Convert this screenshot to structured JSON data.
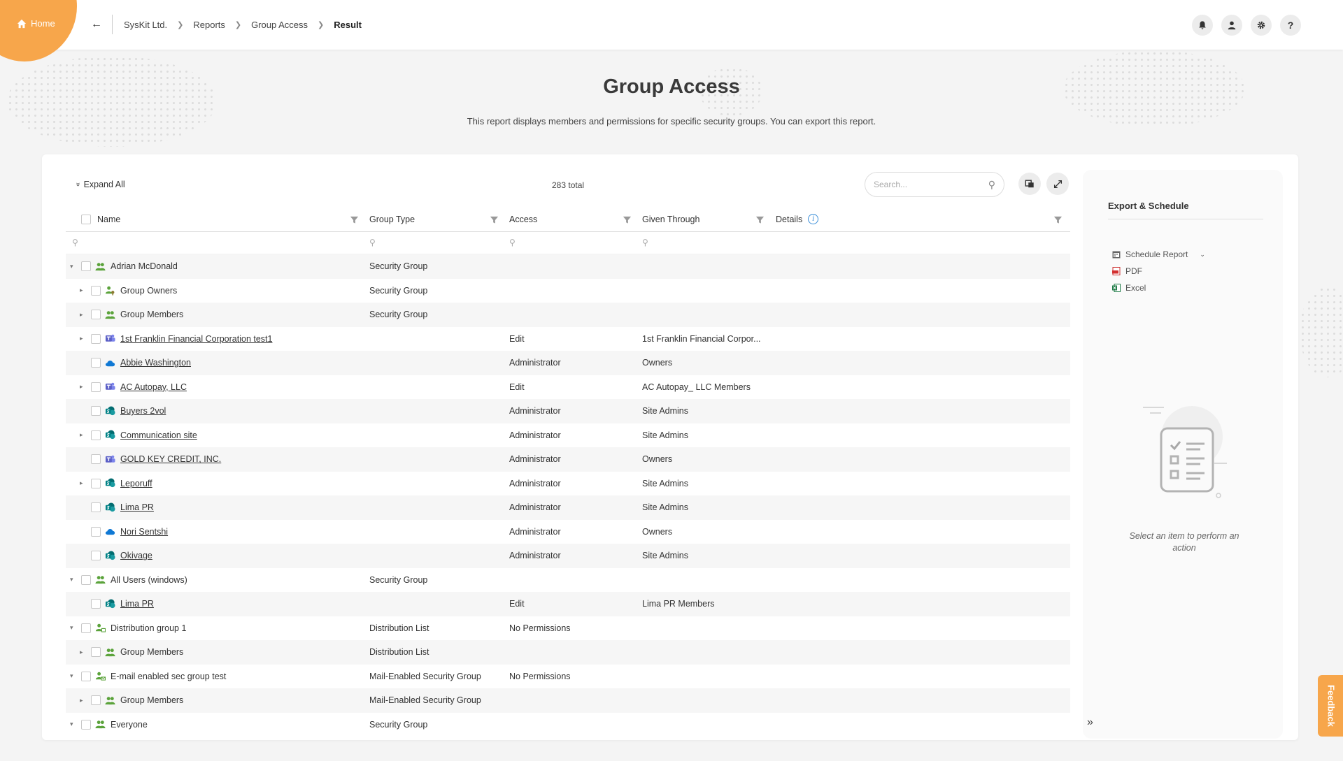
{
  "topbar": {
    "home_label": "Home",
    "breadcrumb": [
      "SysKit Ltd.",
      "Reports",
      "Group Access",
      "Result"
    ],
    "icons": [
      "bell-icon",
      "user-icon",
      "gear-icon",
      "help-icon"
    ]
  },
  "page": {
    "title": "Group Access",
    "description": "This report displays members and permissions for specific security groups. You can export this report."
  },
  "toolbar": {
    "expand_all": "Expand All",
    "total": "283 total",
    "search_placeholder": "Search..."
  },
  "columns": {
    "name": "Name",
    "group_type": "Group Type",
    "access": "Access",
    "given_through": "Given Through",
    "details": "Details"
  },
  "rows": [
    {
      "level": 0,
      "caret": "down",
      "icon": "group",
      "name": "Adrian McDonald",
      "link": false,
      "group_type": "Security Group",
      "access": "",
      "given_through": ""
    },
    {
      "level": 1,
      "caret": "right",
      "icon": "group-owner",
      "name": "Group Owners",
      "link": false,
      "group_type": "Security Group",
      "access": "",
      "given_through": ""
    },
    {
      "level": 1,
      "caret": "right",
      "icon": "group",
      "name": "Group Members",
      "link": false,
      "group_type": "Security Group",
      "access": "",
      "given_through": ""
    },
    {
      "level": 1,
      "caret": "right",
      "icon": "teams",
      "name": "1st Franklin Financial Corporation test1",
      "link": true,
      "group_type": "",
      "access": "Edit",
      "given_through": "1st Franklin Financial Corpor..."
    },
    {
      "level": 1,
      "caret": "",
      "icon": "onedrive",
      "name": "Abbie Washington",
      "link": true,
      "group_type": "",
      "access": "Administrator",
      "given_through": "Owners"
    },
    {
      "level": 1,
      "caret": "right",
      "icon": "teams",
      "name": "AC Autopay, LLC",
      "link": true,
      "group_type": "",
      "access": "Edit",
      "given_through": "AC Autopay_ LLC Members"
    },
    {
      "level": 1,
      "caret": "",
      "icon": "sharepoint",
      "name": "Buyers 2vol",
      "link": true,
      "group_type": "",
      "access": "Administrator",
      "given_through": "Site Admins"
    },
    {
      "level": 1,
      "caret": "right",
      "icon": "sharepoint",
      "name": "Communication site",
      "link": true,
      "group_type": "",
      "access": "Administrator",
      "given_through": "Site Admins"
    },
    {
      "level": 1,
      "caret": "",
      "icon": "teams",
      "name": "GOLD KEY CREDIT, INC.",
      "link": true,
      "group_type": "",
      "access": "Administrator",
      "given_through": "Owners"
    },
    {
      "level": 1,
      "caret": "right",
      "icon": "sharepoint",
      "name": "Leporuff",
      "link": true,
      "group_type": "",
      "access": "Administrator",
      "given_through": "Site Admins"
    },
    {
      "level": 1,
      "caret": "",
      "icon": "sharepoint",
      "name": "Lima PR",
      "link": true,
      "group_type": "",
      "access": "Administrator",
      "given_through": "Site Admins"
    },
    {
      "level": 1,
      "caret": "",
      "icon": "onedrive",
      "name": "Nori Sentshi",
      "link": true,
      "group_type": "",
      "access": "Administrator",
      "given_through": "Owners"
    },
    {
      "level": 1,
      "caret": "",
      "icon": "sharepoint",
      "name": "Okivage",
      "link": true,
      "group_type": "",
      "access": "Administrator",
      "given_through": "Site Admins"
    },
    {
      "level": 0,
      "caret": "down",
      "icon": "group",
      "name": "All Users (windows)",
      "link": false,
      "group_type": "Security Group",
      "access": "",
      "given_through": ""
    },
    {
      "level": 1,
      "caret": "",
      "icon": "sharepoint",
      "name": "Lima PR",
      "link": true,
      "group_type": "",
      "access": "Edit",
      "given_through": "Lima PR Members"
    },
    {
      "level": 0,
      "caret": "down",
      "icon": "group-dist",
      "name": "Distribution group 1",
      "link": false,
      "group_type": "Distribution List",
      "access": "No Permissions",
      "given_through": ""
    },
    {
      "level": 1,
      "caret": "right",
      "icon": "group",
      "name": "Group Members",
      "link": false,
      "group_type": "Distribution List",
      "access": "",
      "given_through": ""
    },
    {
      "level": 0,
      "caret": "down",
      "icon": "group-mail",
      "name": "E-mail enabled sec group test",
      "link": false,
      "group_type": "Mail-Enabled Security Group",
      "access": "No Permissions",
      "given_through": ""
    },
    {
      "level": 1,
      "caret": "right",
      "icon": "group",
      "name": "Group Members",
      "link": false,
      "group_type": "Mail-Enabled Security Group",
      "access": "",
      "given_through": ""
    },
    {
      "level": 0,
      "caret": "down",
      "icon": "group",
      "name": "Everyone",
      "link": false,
      "group_type": "Security Group",
      "access": "",
      "given_through": ""
    }
  ],
  "side_panel": {
    "title": "Export & Schedule",
    "schedule": "Schedule Report",
    "pdf": "PDF",
    "excel": "Excel",
    "empty_text": "Select an item to perform an action"
  },
  "feedback": "Feedback",
  "colors": {
    "accent": "#f7a64b",
    "group_green": "#5ba33b",
    "teams_purple": "#5b5fc7",
    "sharepoint_teal": "#038387",
    "onedrive_blue": "#0f78d4"
  }
}
